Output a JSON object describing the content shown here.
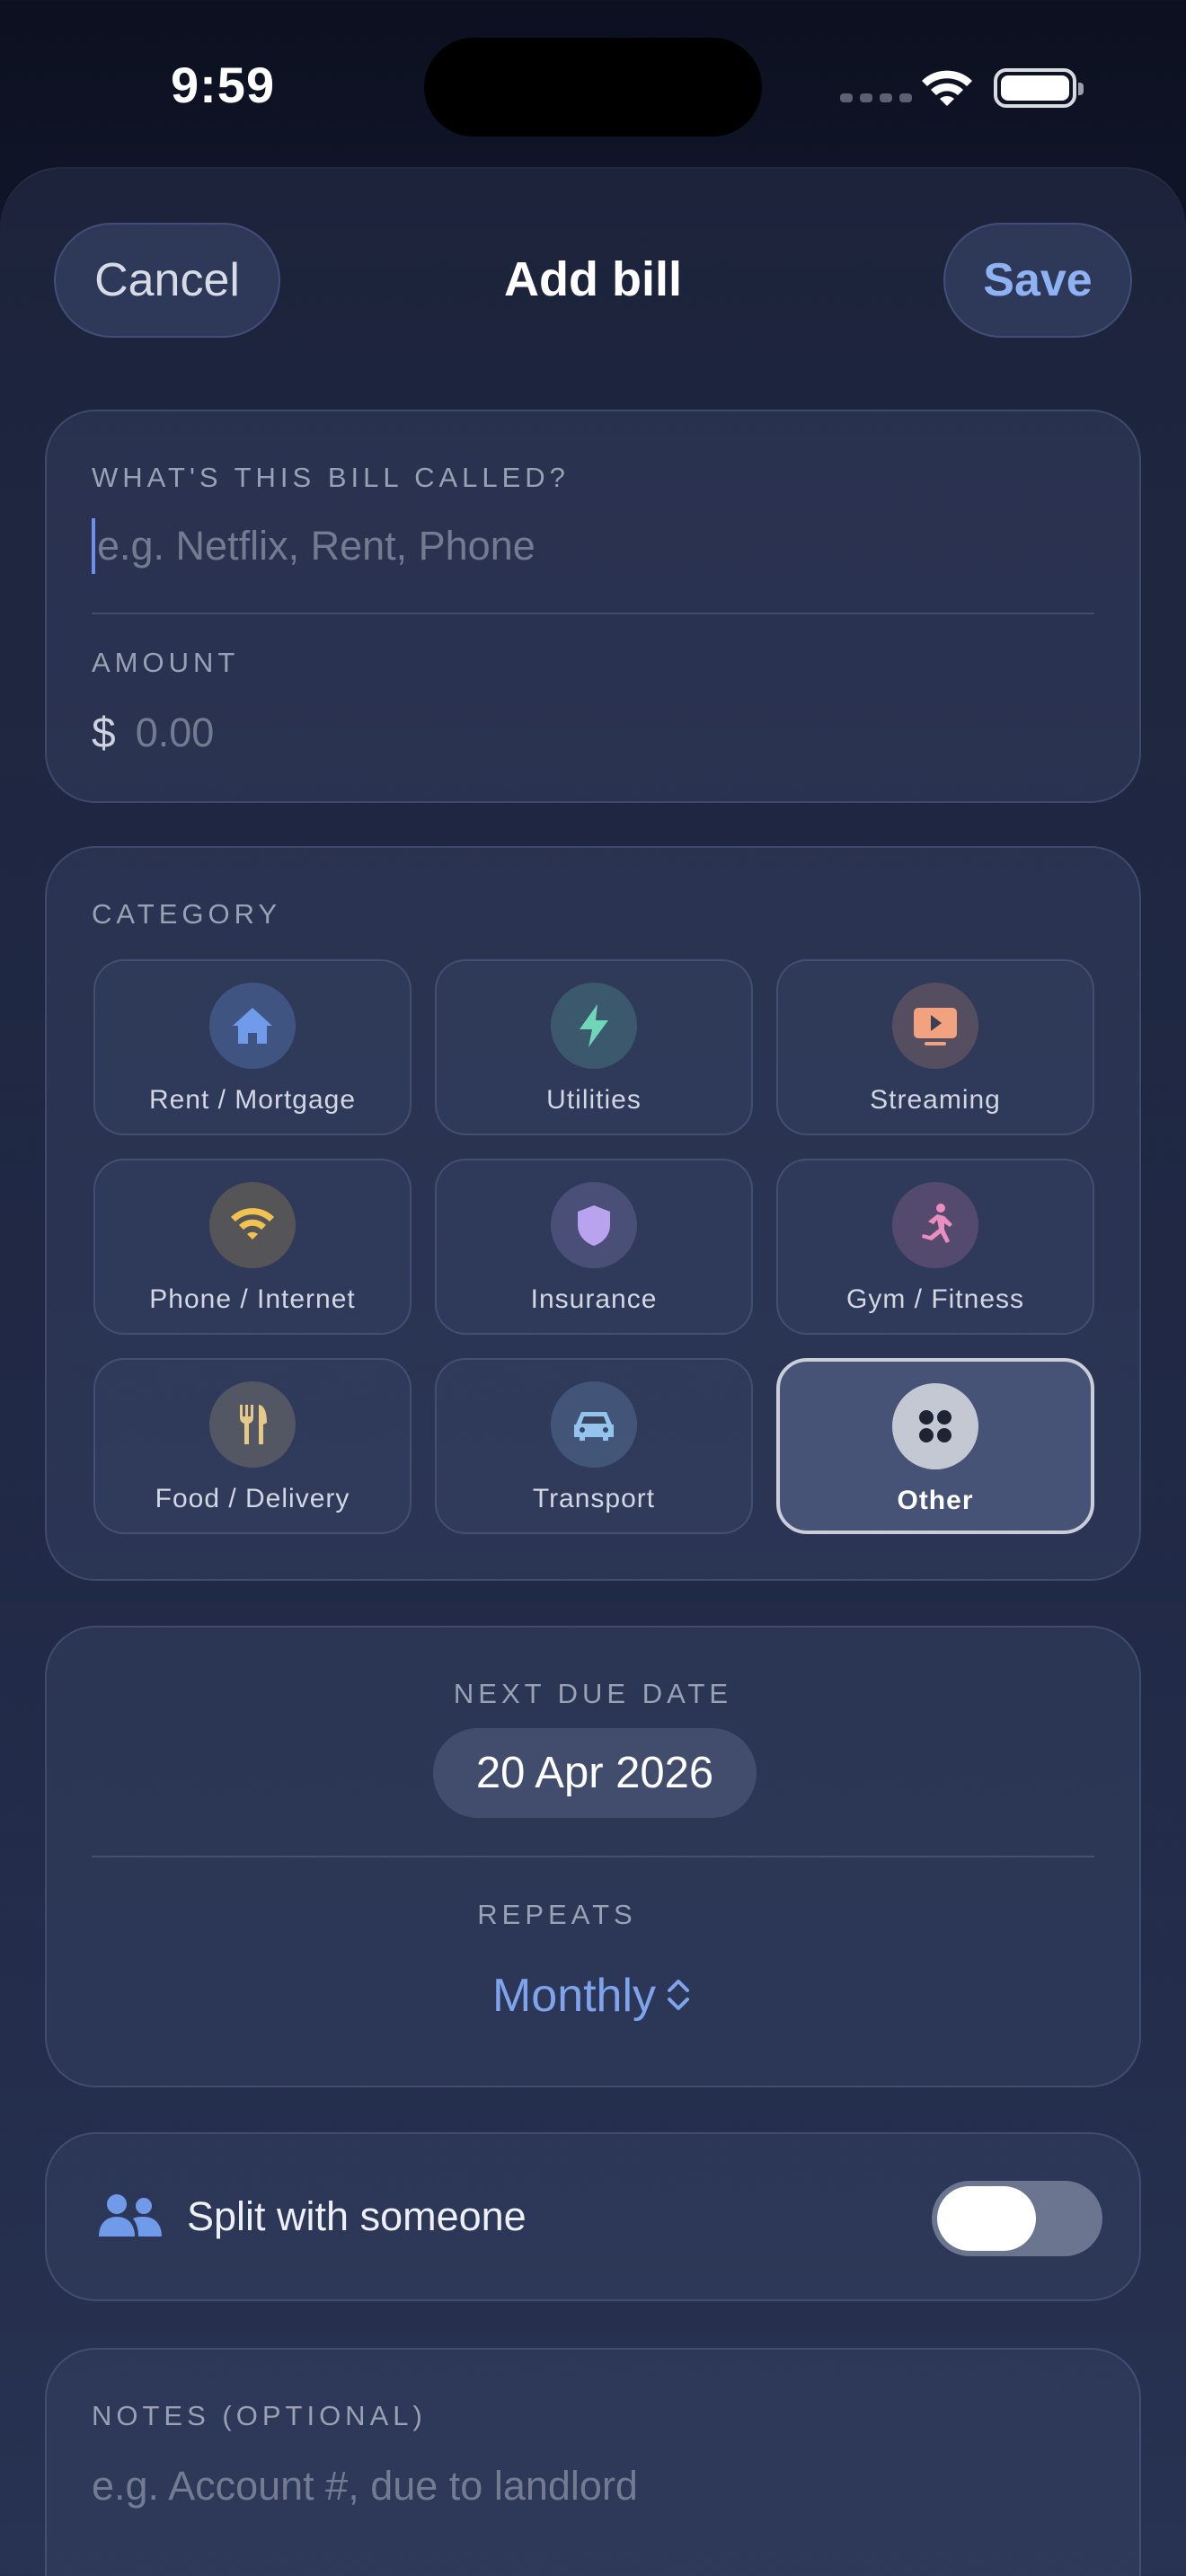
{
  "status_bar": {
    "time": "9:59"
  },
  "header": {
    "cancel_label": "Cancel",
    "title": "Add bill",
    "save_label": "Save"
  },
  "bill": {
    "name_label": "WHAT'S THIS BILL CALLED?",
    "name_placeholder": "e.g. Netflix, Rent, Phone",
    "name_value": "",
    "amount_label": "AMOUNT",
    "currency_symbol": "$",
    "amount_placeholder": "0.00",
    "amount_value": ""
  },
  "category": {
    "label": "CATEGORY",
    "selected": "Other",
    "items": [
      {
        "name": "Rent / Mortgage",
        "icon": "house-icon",
        "color": "#6f9bea"
      },
      {
        "name": "Utilities",
        "icon": "bolt-icon",
        "color": "#6fd6b8"
      },
      {
        "name": "Streaming",
        "icon": "play-screen-icon",
        "color": "#f2a27e"
      },
      {
        "name": "Phone / Internet",
        "icon": "wifi-icon",
        "color": "#f1c24f"
      },
      {
        "name": "Insurance",
        "icon": "shield-icon",
        "color": "#b9a3ef"
      },
      {
        "name": "Gym / Fitness",
        "icon": "runner-icon",
        "color": "#ea8ec0"
      },
      {
        "name": "Food / Delivery",
        "icon": "fork-knife-icon",
        "color": "#e6c888"
      },
      {
        "name": "Transport",
        "icon": "car-icon",
        "color": "#93c4ee"
      },
      {
        "name": "Other",
        "icon": "grid-dots-icon",
        "color": "#1f2435"
      }
    ]
  },
  "schedule": {
    "due_label": "NEXT DUE DATE",
    "due_date": "20 Apr 2026",
    "repeats_label": "REPEATS",
    "repeats_value": "Monthly"
  },
  "split": {
    "label": "Split with someone",
    "enabled": false,
    "icon": "people-icon"
  },
  "notes": {
    "label": "NOTES (OPTIONAL)",
    "placeholder": "e.g. Account #, due to landlord",
    "value": ""
  },
  "colors": {
    "accent": "#7fa4ec",
    "save": "#8fb2f4"
  }
}
